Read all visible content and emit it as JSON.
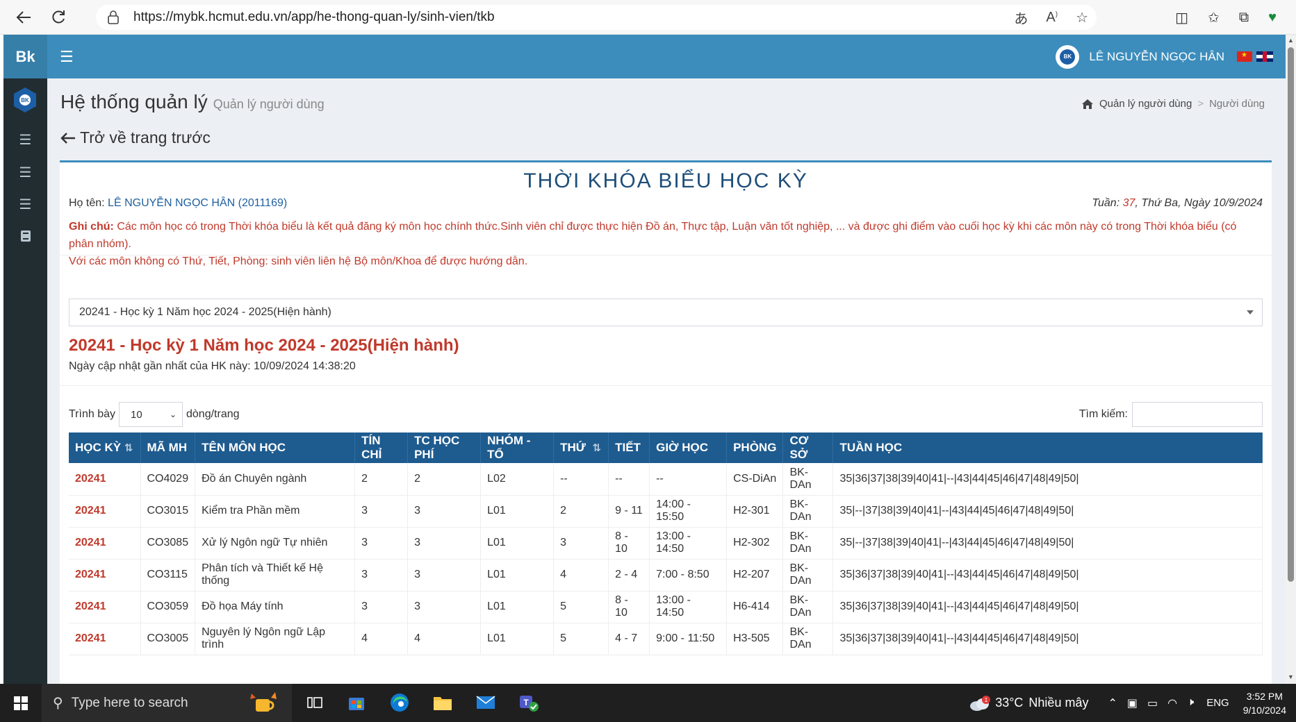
{
  "browser": {
    "url": "https://mybk.hcmut.edu.vn/app/he-thong-quan-ly/sinh-vien/tkb"
  },
  "header": {
    "brand": "Bk",
    "user_name": "LÊ NGUYỄN NGỌC HÂN"
  },
  "page": {
    "title": "Hệ thống quản lý",
    "subtitle": "Quản lý người dùng",
    "breadcrumb_home": "Quản lý người dùng",
    "breadcrumb_current": "Người dùng",
    "back_label": "Trở về trang trước"
  },
  "timetable": {
    "heading": "THỜI KHÓA BIỂU HỌC KỲ",
    "student_label": "Họ tên:",
    "student_name": "LÊ NGUYỄN NGỌC HÂN (2011169)",
    "week_label": "Tuần:",
    "week_number": "37",
    "date_text": ", Thứ Ba, Ngày 10/9/2024",
    "note_label": "Ghi chú:",
    "note_text": "Các môn học có trong Thời khóa biểu là kết quả đăng ký môn học chính thức.Sinh viên chỉ được thực hiện Đồ án, Thực tập, Luận văn tốt nghiệp, ... và được ghi điểm vào cuối học kỳ khi các môn này có trong Thời khóa biểu (có phân nhóm).",
    "note_text2": "Với các môn không có Thứ, Tiết, Phòng: sinh viên liên hệ Bộ môn/Khoa để được hướng dẫn.",
    "semester_selected": "20241 - Học kỳ 1 Năm học 2024 - 2025(Hiện hành)",
    "semester_heading": "20241 - Học kỳ 1 Năm học 2024 - 2025(Hiện hành)",
    "updated_text": "Ngày cập nhật gần nhất của HK này: 10/09/2024 14:38:20",
    "length_prefix": "Trình bày",
    "length_value": "10",
    "length_suffix": "dòng/trang",
    "search_label": "Tìm kiếm:",
    "columns": [
      "HỌC KỲ",
      "MÃ MH",
      "TÊN MÔN HỌC",
      "TÍN CHỈ",
      "TC HỌC PHÍ",
      "NHÓM - TỔ",
      "THỨ",
      "TIẾT",
      "GIỜ HỌC",
      "PHÒNG",
      "CƠ SỞ",
      "TUẦN HỌC"
    ],
    "rows": [
      [
        "20241",
        "CO4029",
        "Đồ án Chuyên ngành",
        "2",
        "2",
        "L02",
        "--",
        "--",
        "--",
        "CS-DiAn",
        "BK-DAn",
        "35|36|37|38|39|40|41|--|43|44|45|46|47|48|49|50|"
      ],
      [
        "20241",
        "CO3015",
        "Kiểm tra Phần mềm",
        "3",
        "3",
        "L01",
        "2",
        "9 - 11",
        "14:00 - 15:50",
        "H2-301",
        "BK-DAn",
        "35|--|37|38|39|40|41|--|43|44|45|46|47|48|49|50|"
      ],
      [
        "20241",
        "CO3085",
        "Xử lý Ngôn ngữ Tự nhiên",
        "3",
        "3",
        "L01",
        "3",
        "8 - 10",
        "13:00 - 14:50",
        "H2-302",
        "BK-DAn",
        "35|--|37|38|39|40|41|--|43|44|45|46|47|48|49|50|"
      ],
      [
        "20241",
        "CO3115",
        "Phân tích và Thiết kế Hệ thống",
        "3",
        "3",
        "L01",
        "4",
        "2 - 4",
        "7:00 - 8:50",
        "H2-207",
        "BK-DAn",
        "35|36|37|38|39|40|41|--|43|44|45|46|47|48|49|50|"
      ],
      [
        "20241",
        "CO3059",
        "Đồ họa Máy tính",
        "3",
        "3",
        "L01",
        "5",
        "8 - 10",
        "13:00 - 14:50",
        "H6-414",
        "BK-DAn",
        "35|36|37|38|39|40|41|--|43|44|45|46|47|48|49|50|"
      ],
      [
        "20241",
        "CO3005",
        "Nguyên lý Ngôn ngữ Lập trình",
        "4",
        "4",
        "L01",
        "5",
        "4 - 7",
        "9:00 - 11:50",
        "H3-505",
        "BK-DAn",
        "35|36|37|38|39|40|41|--|43|44|45|46|47|48|49|50|"
      ]
    ]
  },
  "taskbar": {
    "search_placeholder": "Type here to search",
    "weather_temp": "33°C",
    "weather_desc": "Nhiều mây",
    "weather_badge": "1",
    "lang": "ENG",
    "time": "3:52 PM",
    "date": "9/10/2024"
  },
  "colors": {
    "header_bg": "#3c8dbc",
    "sidebar_bg": "#222d32",
    "table_header_bg": "#1e5b8f",
    "accent_red": "#c0392b"
  },
  "icons": {
    "browser": [
      "back-arrow-icon",
      "reload-icon",
      "lock-icon",
      "read-aloud-icon",
      "text-size-icon",
      "favorite-star-icon",
      "split-screen-icon",
      "favorites-icon",
      "collections-icon",
      "performance-icon"
    ],
    "sidebar": [
      "menu-icon",
      "menu-icon",
      "menu-icon",
      "book-icon"
    ]
  }
}
